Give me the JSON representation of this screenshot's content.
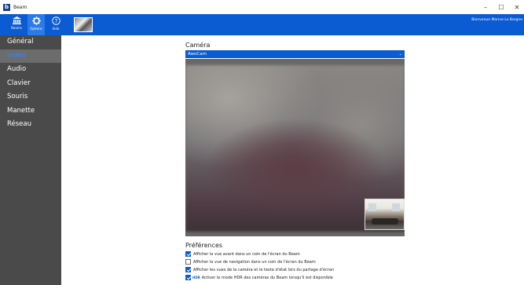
{
  "window": {
    "title": "Beam",
    "logo_letter": "b",
    "controls": {
      "minimize": "–",
      "maximize": "☐",
      "close": "✕"
    }
  },
  "toolbar": {
    "buttons": [
      {
        "label": "Beams",
        "icon": "building-icon"
      },
      {
        "label": "Options",
        "icon": "gear-icon"
      },
      {
        "label": "Aide",
        "icon": "help-icon"
      }
    ],
    "active": "Options",
    "welcome": "Bienvenue Marine Le Borgne"
  },
  "sidebar": {
    "items": [
      {
        "label": "Général"
      },
      {
        "label": "Vidéo"
      },
      {
        "label": "Audio"
      },
      {
        "label": "Clavier"
      },
      {
        "label": "Souris"
      },
      {
        "label": "Manette"
      },
      {
        "label": "Réseau"
      }
    ],
    "selected": "Vidéo"
  },
  "camera": {
    "title": "Caméra",
    "selected": "AwoCam"
  },
  "preferences": {
    "title": "Préférences",
    "items": [
      {
        "label": "Afficher la vue avant dans un coin de l'écran du Beam",
        "checked": true
      },
      {
        "label": "Afficher la vue de navigation dans un coin de l'écran du Beam",
        "checked": false
      },
      {
        "label": "Afficher les vues de la caméra et le texte d'état lors du partage d'écran",
        "checked": true
      },
      {
        "label": "Activer le mode HDR des caméras du Beam lorsqu'il est disponible",
        "checked": true,
        "badge": "HDR"
      }
    ]
  },
  "colors": {
    "accent": "#0b5bd3",
    "sidebar_bg": "#4a4a4a",
    "sidebar_selected": "#6c6c6c",
    "selected_text": "#3a86f0"
  }
}
